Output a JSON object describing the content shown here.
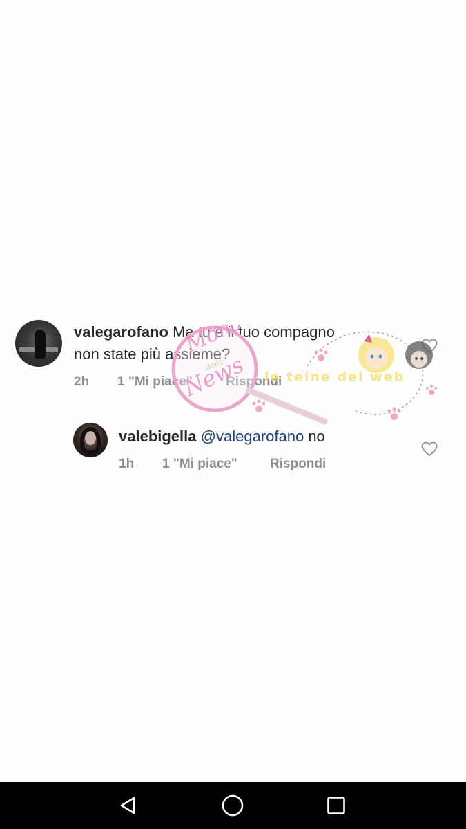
{
  "comments": [
    {
      "username": "valegarofano",
      "text_line1": "Ma tu e il tuo compagno",
      "text_line2": "non state più assieme?",
      "time": "2h",
      "likes": "1 \"Mi piace\"",
      "reply_label": "Rispondi",
      "avatar_icon": "user-avatar-icon"
    },
    {
      "username": "valebigella",
      "mention": "@valegarofano",
      "text": "no",
      "time": "1h",
      "likes": "1 \"Mi piace\"",
      "reply_label": "Rispondi",
      "avatar_icon": "user-avatar-icon"
    }
  ],
  "watermark": {
    "brand_line1": "Mondo",
    "brand_line2": "delle",
    "brand_line3": "News",
    "brand_right": "le teine del web"
  },
  "navbar": {
    "back_icon": "back-triangle-icon",
    "home_icon": "home-circle-icon",
    "recents_icon": "recents-square-icon",
    "background": "#000000"
  },
  "colors": {
    "text": "#262626",
    "meta": "#8e8e8e",
    "mention": "#1d3f7a",
    "watermark_pink": "#e58fbf"
  }
}
